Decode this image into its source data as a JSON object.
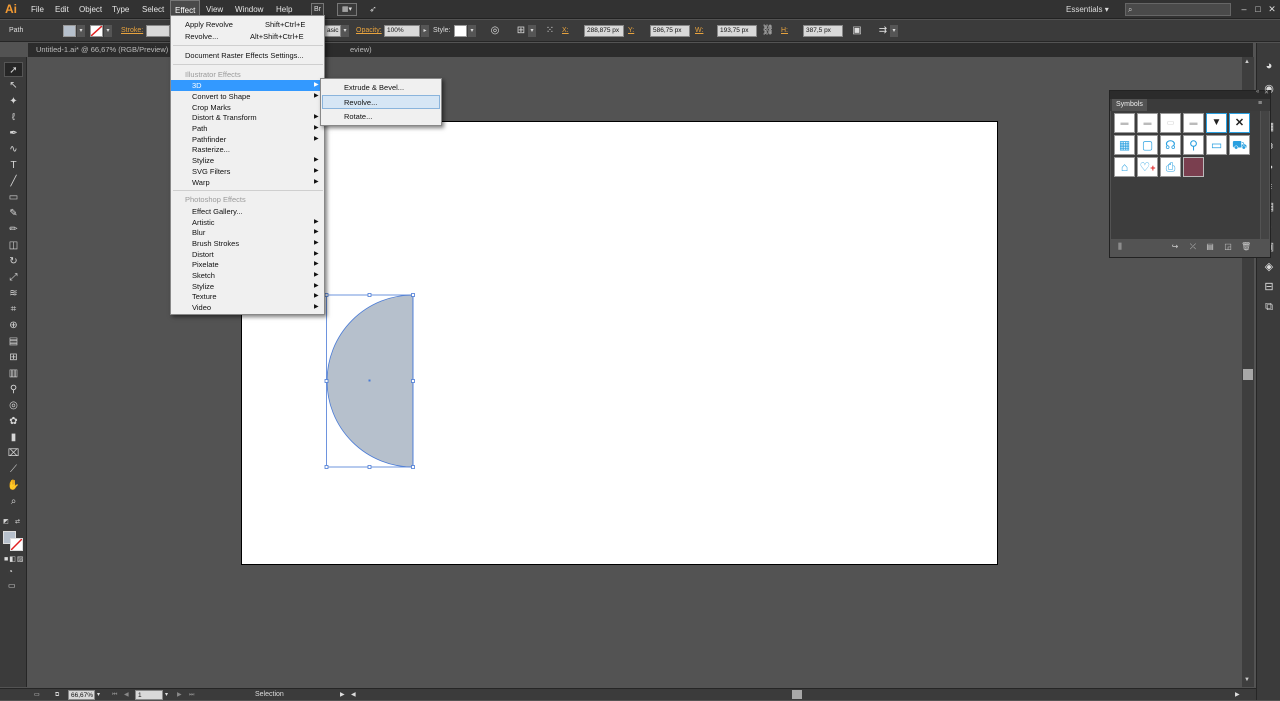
{
  "app": {
    "logo": "Ai"
  },
  "menubar": {
    "items": [
      "File",
      "Edit",
      "Object",
      "Type",
      "Select",
      "Effect",
      "View",
      "Window",
      "Help"
    ],
    "bridge": "Br",
    "workspace": "Essentials"
  },
  "controlbar": {
    "selection_type": "Path",
    "stroke_label": "Stroke:",
    "style_visible": "asic",
    "opacity_label": "Opacity:",
    "opacity_value": "100%",
    "style_label": "Style:",
    "x_label": "X:",
    "x_value": "288,875 px",
    "y_label": "Y:",
    "y_value": "586,75 px",
    "w_label": "W:",
    "w_value": "193,75 px",
    "h_label": "H:",
    "h_value": "387,5 px"
  },
  "document": {
    "tab_title": "Untitled-1.ai* @ 66,67% (RGB/Preview)",
    "tab_title_tail": "eview)"
  },
  "effect_menu": {
    "apply_last": "Apply Revolve",
    "apply_last_shortcut": "Shift+Ctrl+E",
    "last_effect": "Revolve...",
    "last_effect_shortcut": "Alt+Shift+Ctrl+E",
    "doc_raster": "Document Raster Effects Settings...",
    "illustrator_header": "Illustrator Effects",
    "illustrator_items": [
      "3D",
      "Convert to Shape",
      "Crop Marks",
      "Distort & Transform",
      "Path",
      "Pathfinder",
      "Rasterize...",
      "Stylize",
      "SVG Filters",
      "Warp"
    ],
    "photoshop_header": "Photoshop Effects",
    "photoshop_items": [
      "Effect Gallery...",
      "Artistic",
      "Blur",
      "Brush Strokes",
      "Distort",
      "Pixelate",
      "Sketch",
      "Stylize",
      "Texture",
      "Video"
    ]
  },
  "submenu_3d": {
    "items": [
      "Extrude & Bevel...",
      "Revolve...",
      "Rotate..."
    ],
    "highlighted": "Revolve..."
  },
  "symbols_panel": {
    "title": "Symbols"
  },
  "statusbar": {
    "zoom": "66,67%",
    "page": "1",
    "tool": "Selection"
  },
  "colors": {
    "menu_highlight": "#3399ff",
    "submenu_highlight": "#d6e6f5",
    "shape_fill": "#b6c0cc",
    "selection_blue": "#4a7bd6",
    "accent_orange": "#e8a33e"
  }
}
